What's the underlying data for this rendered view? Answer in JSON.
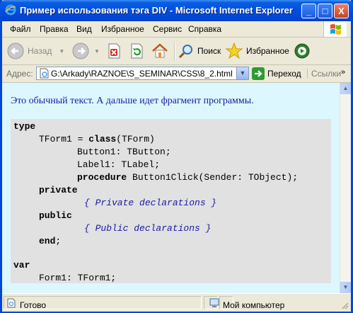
{
  "window": {
    "title": "Пример использования тэга DIV - Microsoft Internet Explorer",
    "min_label": "_",
    "max_label": "□",
    "close_label": "X"
  },
  "menu": {
    "items": [
      {
        "label": "Файл"
      },
      {
        "label": "Правка"
      },
      {
        "label": "Вид"
      },
      {
        "label": "Избранное"
      },
      {
        "label": "Сервис"
      },
      {
        "label": "Справка"
      }
    ]
  },
  "toolbar": {
    "back_label": "Назад",
    "search_label": "Поиск",
    "favorites_label": "Избранное"
  },
  "address": {
    "label": "Адрес:",
    "value": "G:\\Arkady\\RAZNOE\\S_SEMINAR\\CSS\\8_2.html",
    "go_label": "Переход",
    "links_label": "Ссылки",
    "more": "»"
  },
  "content": {
    "intro": "Это обычный текст. А дальше идет фрагмент программы.",
    "code": {
      "l1_kw": "type",
      "l2_a": "TForm1 = ",
      "l2_kw": "class",
      "l2_b": "(TForm)",
      "l3": "Button1: TButton;",
      "l4": "Label1: TLabel;",
      "l5_kw": "procedure",
      "l5_b": " Button1Click(Sender: TObject);",
      "l6_kw": "private",
      "l7_cm": "{ Private declarations }",
      "l8_kw": "public",
      "l9_cm": "{ Public declarations }",
      "l10_kw": "end",
      "l10_b": ";",
      "l11_kw": "var",
      "l12": "Form1: TForm1;"
    }
  },
  "status": {
    "text": "Готово",
    "zone": "Мой компьютер"
  },
  "colors": {
    "title_blue": "#0050e6",
    "page_bg": "#ddf7ff",
    "code_bg": "#e1e1e1",
    "intro_text": "#1a1aa6"
  }
}
